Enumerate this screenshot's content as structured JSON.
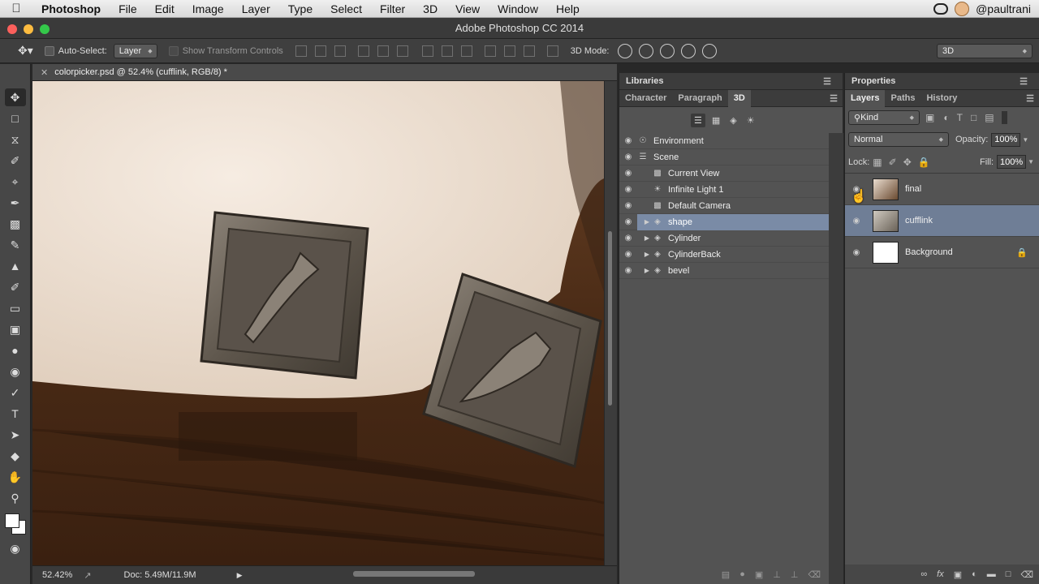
{
  "menubar": {
    "app": "Photoshop",
    "items": [
      "File",
      "Edit",
      "Image",
      "Layer",
      "Type",
      "Select",
      "Filter",
      "3D",
      "View",
      "Window",
      "Help"
    ],
    "user": "@paultrani"
  },
  "window": {
    "title": "Adobe Photoshop CC 2014"
  },
  "options": {
    "auto_select_label": "Auto-Select:",
    "auto_select_value": "Layer",
    "show_transform": "Show Transform Controls",
    "mode_3d_label": "3D Mode:",
    "workspace": "3D"
  },
  "document": {
    "tab": "colorpicker.psd @ 52.4% (cufflink, RGB/8) *",
    "zoom": "52.42%",
    "doc_info": "Doc: 5.49M/11.9M"
  },
  "libraries": {
    "title": "Libraries"
  },
  "panel3d": {
    "tabs": [
      "Character",
      "Paragraph",
      "3D"
    ],
    "active_tab": "3D",
    "items": [
      {
        "name": "Environment",
        "indent": 0,
        "icon": "environment-icon",
        "expand": false
      },
      {
        "name": "Scene",
        "indent": 0,
        "icon": "scene-icon",
        "expand": false
      },
      {
        "name": "Current View",
        "indent": 1,
        "icon": "camera-icon",
        "expand": false
      },
      {
        "name": "Infinite Light 1",
        "indent": 1,
        "icon": "light-icon",
        "expand": false
      },
      {
        "name": "Default Camera",
        "indent": 1,
        "icon": "camera-icon",
        "expand": false
      },
      {
        "name": "shape",
        "indent": 1,
        "icon": "mesh-icon",
        "expand": true,
        "selected": true
      },
      {
        "name": "Cylinder",
        "indent": 1,
        "icon": "mesh-icon",
        "expand": true
      },
      {
        "name": "CylinderBack",
        "indent": 1,
        "icon": "mesh-icon",
        "expand": true
      },
      {
        "name": "bevel",
        "indent": 1,
        "icon": "mesh-icon",
        "expand": true
      }
    ]
  },
  "properties": {
    "title": "Properties"
  },
  "layers": {
    "tabs": [
      "Layers",
      "Paths",
      "History"
    ],
    "active_tab": "Layers",
    "kind": "Kind",
    "blend": "Normal",
    "opacity_label": "Opacity:",
    "opacity": "100%",
    "lock_label": "Lock:",
    "fill_label": "Fill:",
    "fill": "100%",
    "items": [
      {
        "name": "final",
        "selected": false,
        "locked": false
      },
      {
        "name": "cufflink",
        "selected": true,
        "locked": false
      },
      {
        "name": "Background",
        "selected": false,
        "locked": true
      }
    ]
  },
  "colors": {
    "accent": "#7a8ba6",
    "layer_selected": "#6f7e96"
  }
}
